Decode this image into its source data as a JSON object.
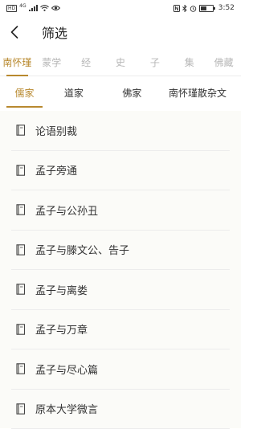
{
  "status_bar": {
    "left": [
      "HD",
      "4G",
      "signal",
      "wifi",
      "eye"
    ],
    "time": "3:52",
    "right_icons": [
      "nfc-icon",
      "bluetooth-icon",
      "alarm-icon",
      "battery-icon"
    ]
  },
  "header": {
    "title": "筛选",
    "back_icon": "chevron-left-icon"
  },
  "category_tabs": [
    {
      "label": "南怀瑾",
      "active": true
    },
    {
      "label": "蒙学",
      "active": false
    },
    {
      "label": "经",
      "active": false
    },
    {
      "label": "史",
      "active": false
    },
    {
      "label": "子",
      "active": false
    },
    {
      "label": "集",
      "active": false
    },
    {
      "label": "佛藏",
      "active": false
    }
  ],
  "sub_tabs": [
    {
      "label": "儒家",
      "active": true
    },
    {
      "label": "道家",
      "active": false
    },
    {
      "label": "佛家",
      "active": false
    },
    {
      "label": "南怀瑾散杂文",
      "active": false
    }
  ],
  "books": [
    {
      "title": "论语别裁",
      "icon": "book-icon"
    },
    {
      "title": "孟子旁通",
      "icon": "book-icon"
    },
    {
      "title": "孟子与公孙丑",
      "icon": "book-icon"
    },
    {
      "title": "孟子与滕文公、告子",
      "icon": "book-icon"
    },
    {
      "title": "孟子与离娄",
      "icon": "book-icon"
    },
    {
      "title": "孟子与万章",
      "icon": "book-icon"
    },
    {
      "title": "孟子与尽心篇",
      "icon": "book-icon"
    },
    {
      "title": "原本大学微言",
      "icon": "book-icon"
    }
  ],
  "colors": {
    "accent": "#b8892e",
    "inactive_tab": "#b7b7b7",
    "list_bg": "#fbfbf8",
    "divider": "#ececec"
  }
}
